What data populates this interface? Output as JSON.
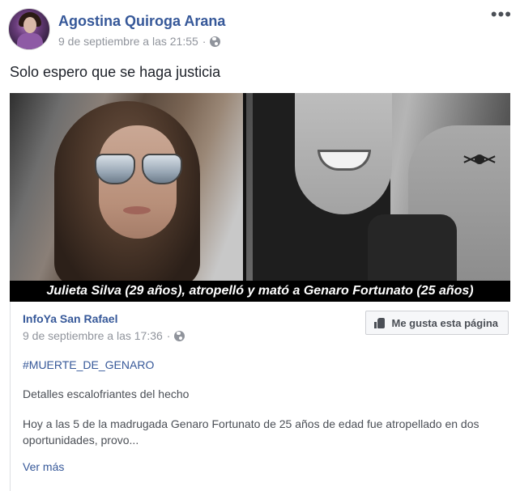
{
  "post": {
    "author": "Agostina Quiroga Arana",
    "timestamp": "9 de septiembre a las 21:55",
    "privacy_icon": "globe-icon",
    "more_label": "•••",
    "text": "Solo espero que se haga justicia"
  },
  "photo": {
    "caption": "Julieta Silva (29 años), atropelló y mató a Genaro Fortunato (25 años)"
  },
  "shared": {
    "page_name": "InfoYa San Rafael",
    "timestamp": "9 de septiembre a las 17:36",
    "like_page_label": "Me gusta esta página",
    "hashtag": "#MUERTE_DE_GENARO",
    "subtitle": "Detalles escalofriantes del hecho",
    "body": "Hoy a las 5 de la madrugada Genaro Fortunato de 25 años de edad fue atropellado en dos oportunidades, provo...",
    "see_more": "Ver más"
  },
  "colors": {
    "link": "#365899",
    "meta": "#90949c",
    "text": "#1d2129"
  }
}
